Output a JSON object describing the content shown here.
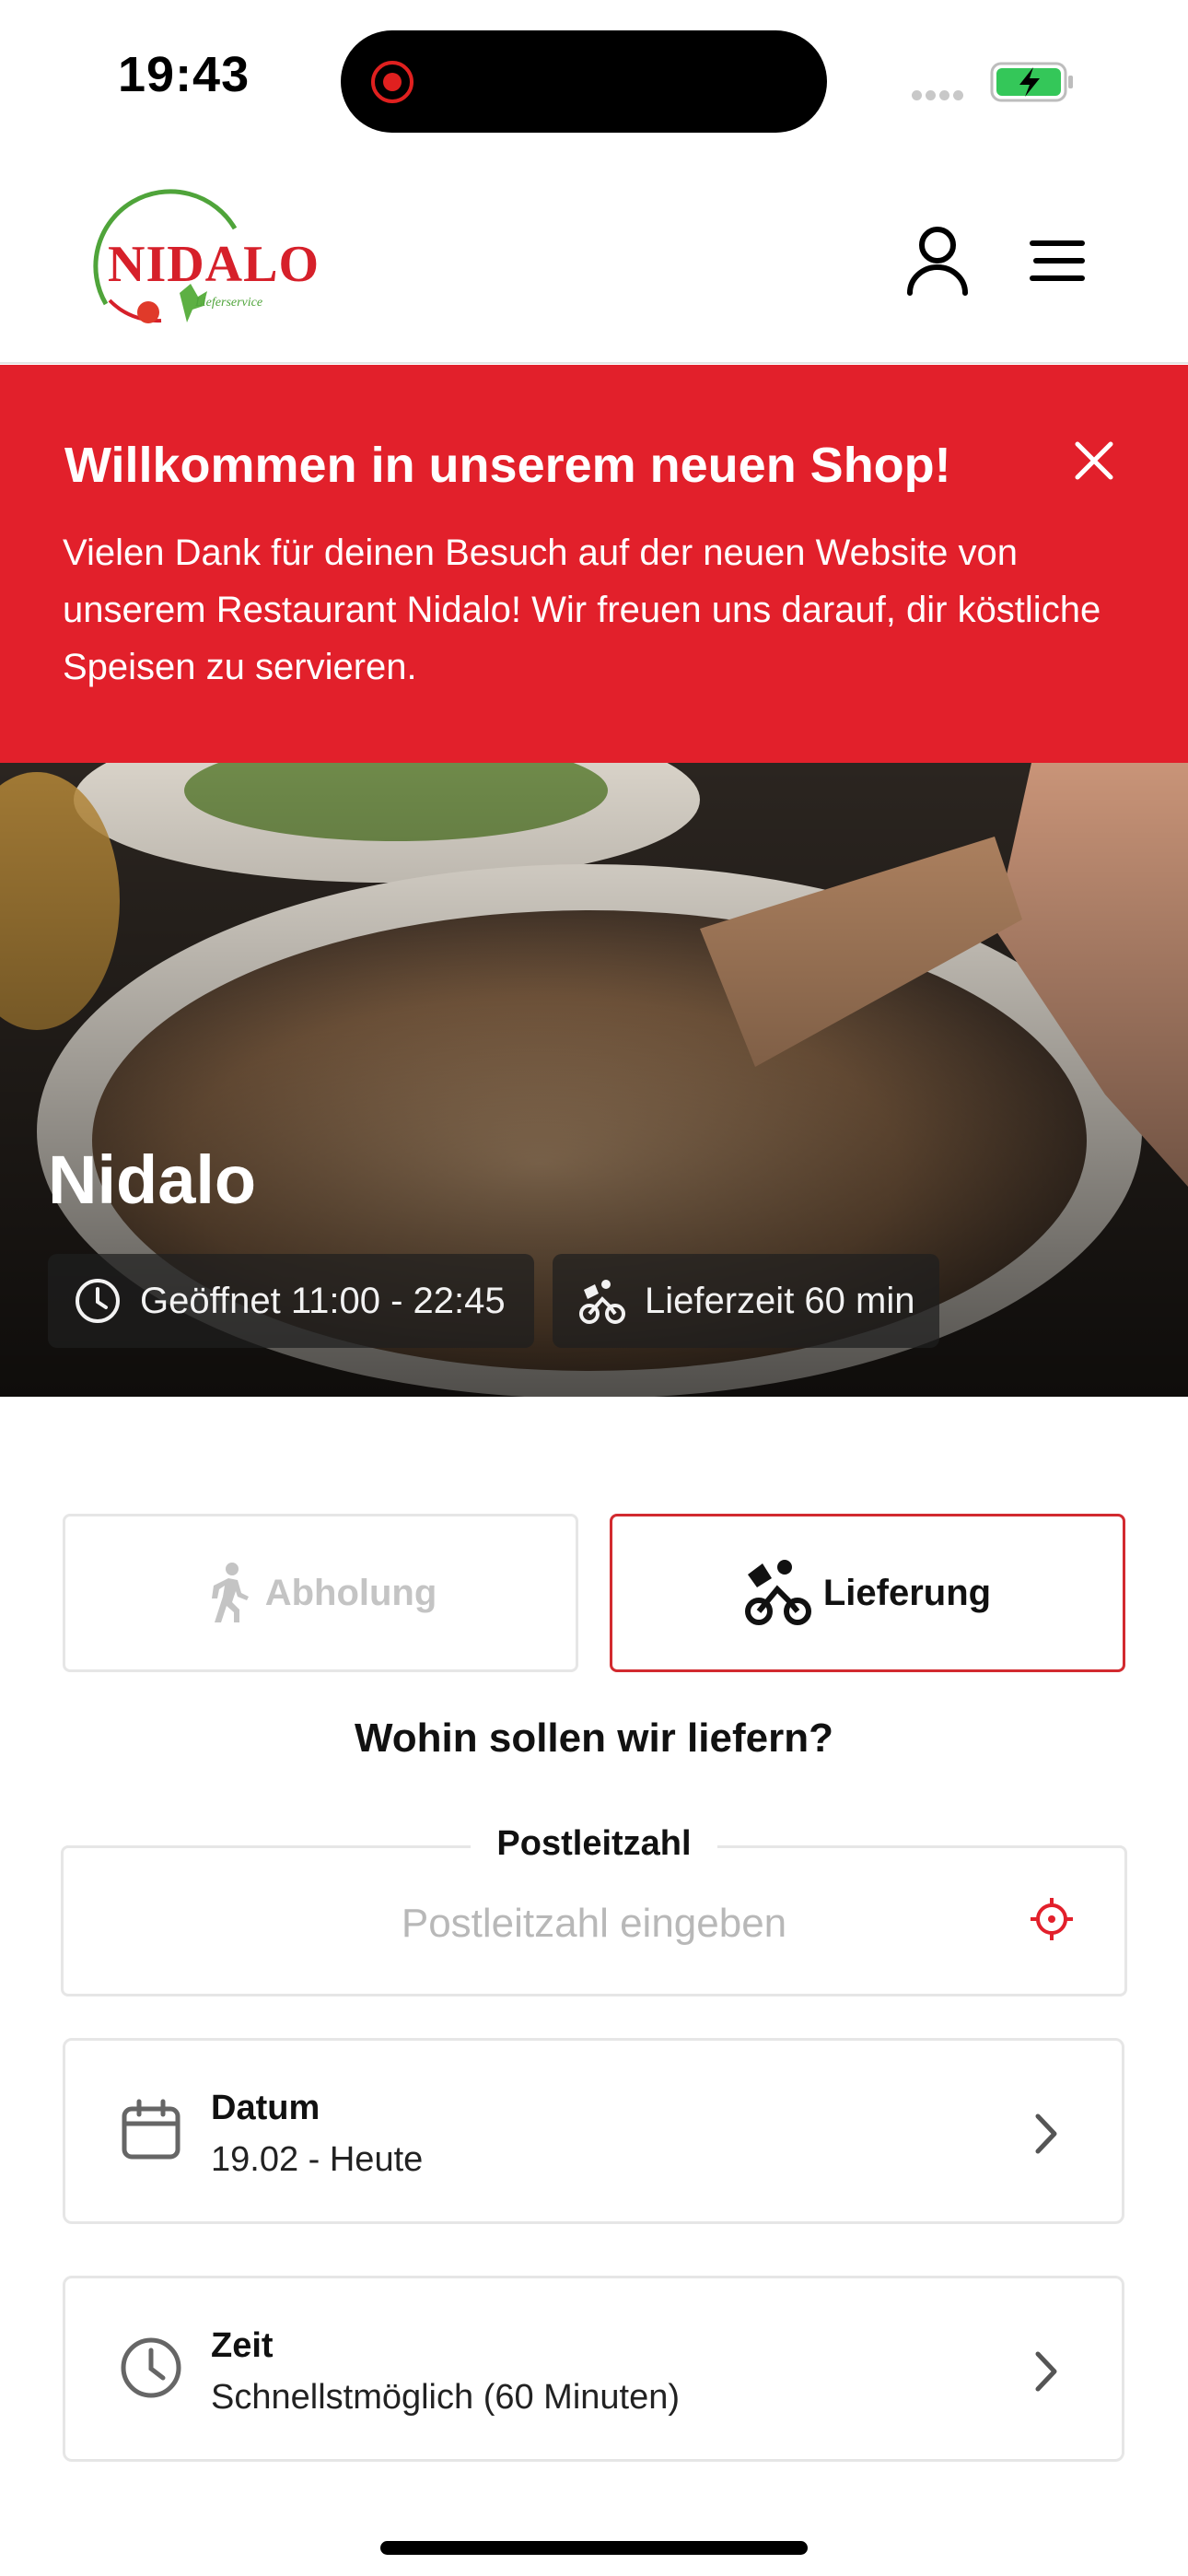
{
  "status_bar": {
    "time": "19:43"
  },
  "header": {
    "logo_text": "NIDALO",
    "logo_subtext": "Lieferservice"
  },
  "banner": {
    "title": "Willkommen in unserem neuen Shop!",
    "text": "Vielen Dank für deinen Besuch auf der neuen Website von unserem Restaurant Nidalo! Wir freuen uns darauf, dir köstliche Speisen zu servieren."
  },
  "hero": {
    "name": "Nidalo",
    "hours": "Geöffnet 11:00 - 22:45",
    "delivery_time": "Lieferzeit 60 min"
  },
  "order_mode": {
    "pickup_label": "Abholung",
    "delivery_label": "Lieferung",
    "selected": "Lieferung"
  },
  "delivery_form": {
    "question": "Wohin sollen wir liefern?",
    "zip_label": "Postleitzahl",
    "zip_placeholder": "Postleitzahl eingeben",
    "zip_value": "",
    "date_title": "Datum",
    "date_value": "19.02 - Heute",
    "time_title": "Zeit",
    "time_value": "Schnellstmöglich (60 Minuten)"
  },
  "colors": {
    "brand_red": "#e2202b",
    "accent_border": "#d22a2f",
    "battery_green": "#34c759"
  },
  "icons": {
    "user": "user-icon",
    "menu": "menu-icon",
    "close": "close-icon",
    "clock": "clock-icon",
    "bike": "bike-delivery-icon",
    "walk": "walking-icon",
    "locate": "locate-icon",
    "calendar": "calendar-icon",
    "chevron": "chevron-right-icon"
  }
}
